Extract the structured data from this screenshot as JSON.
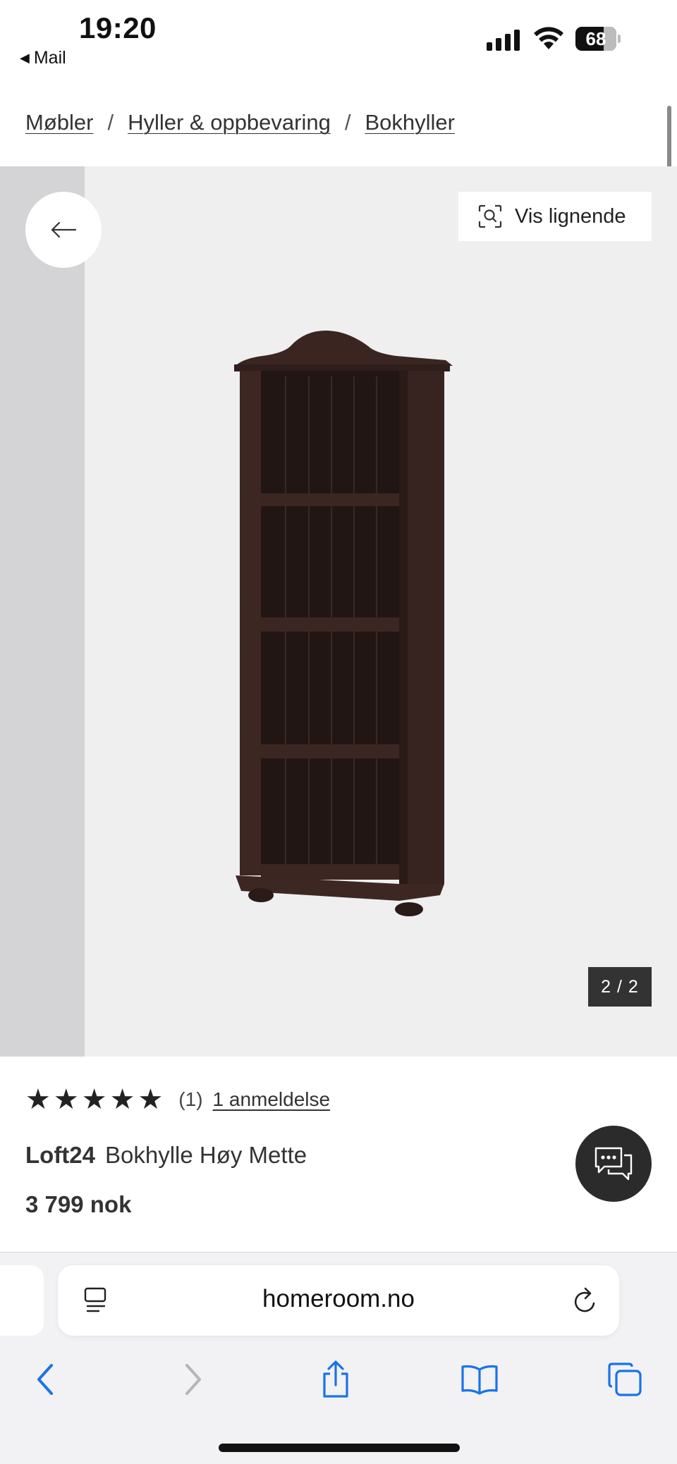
{
  "status": {
    "time": "19:20",
    "back_app": "Mail",
    "battery": "68"
  },
  "breadcrumb": [
    "Møbler",
    "Hyller & oppbevaring",
    "Bokhyller"
  ],
  "gallery": {
    "similar_label": "Vis lignende",
    "counter": "2 / 2"
  },
  "product": {
    "rating_count": "(1)",
    "rating_link": "1 anmeldelse",
    "stars": 5,
    "brand": "Loft24",
    "name": "Bokhylle Høy Mette",
    "price": "3 799 nok"
  },
  "browser": {
    "url": "homeroom.no"
  },
  "colors": {
    "counter_bg": "#333333",
    "chat_bg": "#2b2b2b",
    "ios_blue": "#1a73e8",
    "shelf_wood": "#3a2521"
  },
  "icons": {
    "back": "arrow-left-icon",
    "similar": "visual-search-icon",
    "chat": "chat-icon",
    "reader": "reader-icon",
    "reload": "reload-icon",
    "nav_back": "chevron-left-icon",
    "nav_forward": "chevron-right-icon",
    "share": "share-icon",
    "bookmarks": "book-icon",
    "tabs": "tabs-icon"
  }
}
